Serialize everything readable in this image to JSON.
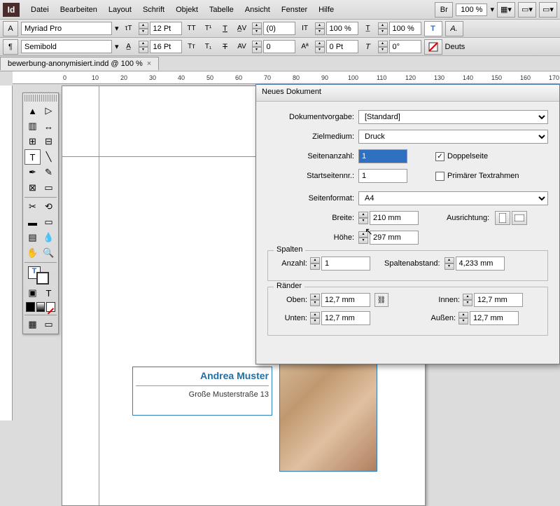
{
  "menu": {
    "items": [
      "Datei",
      "Bearbeiten",
      "Layout",
      "Schrift",
      "Objekt",
      "Tabelle",
      "Ansicht",
      "Fenster",
      "Hilfe"
    ],
    "zoom": "100 %",
    "br": "Br"
  },
  "opts": {
    "font": "Myriad Pro",
    "weight": "Semibold",
    "size": "12 Pt",
    "leading": "16 Pt",
    "kerning": "(0)",
    "tracking": "0",
    "vscale": "100 %",
    "hscale": "100 %",
    "baseline": "0 Pt",
    "rotation": "0°",
    "lang": "Deuts"
  },
  "tab": {
    "title": "bewerbung-anonymisiert.indd @ 100 %"
  },
  "ruler": {
    "marks": [
      "0",
      "10",
      "20",
      "30",
      "40",
      "50",
      "60",
      "70",
      "80",
      "90",
      "100",
      "110",
      "120",
      "130",
      "140",
      "150",
      "160",
      "170"
    ]
  },
  "doc": {
    "name": "Andrea Muster",
    "addr": "Große Musterstraße 13"
  },
  "dlg": {
    "title": "Neues Dokument",
    "preset_label": "Dokumentvorgabe:",
    "preset": "[Standard]",
    "intent_label": "Zielmedium:",
    "intent": "Druck",
    "pages_label": "Seitenanzahl:",
    "pages": "1",
    "facing_label": "Doppelseite",
    "startpage_label": "Startseitennr.:",
    "startpage": "1",
    "primary_label": "Primärer Textrahmen",
    "pagesize_label": "Seitenformat:",
    "pagesize": "A4",
    "width_label": "Breite:",
    "width": "210 mm",
    "height_label": "Höhe:",
    "height": "297 mm",
    "orient_label": "Ausrichtung:",
    "cols_legend": "Spalten",
    "cols_count_label": "Anzahl:",
    "cols_count": "1",
    "gutter_label": "Spaltenabstand:",
    "gutter": "4,233 mm",
    "margins_legend": "Ränder",
    "top_label": "Oben:",
    "top": "12,7 mm",
    "bottom_label": "Unten:",
    "bottom": "12,7 mm",
    "inside_label": "Innen:",
    "inside": "12,7 mm",
    "outside_label": "Außen:",
    "outside": "12,7 mm"
  }
}
